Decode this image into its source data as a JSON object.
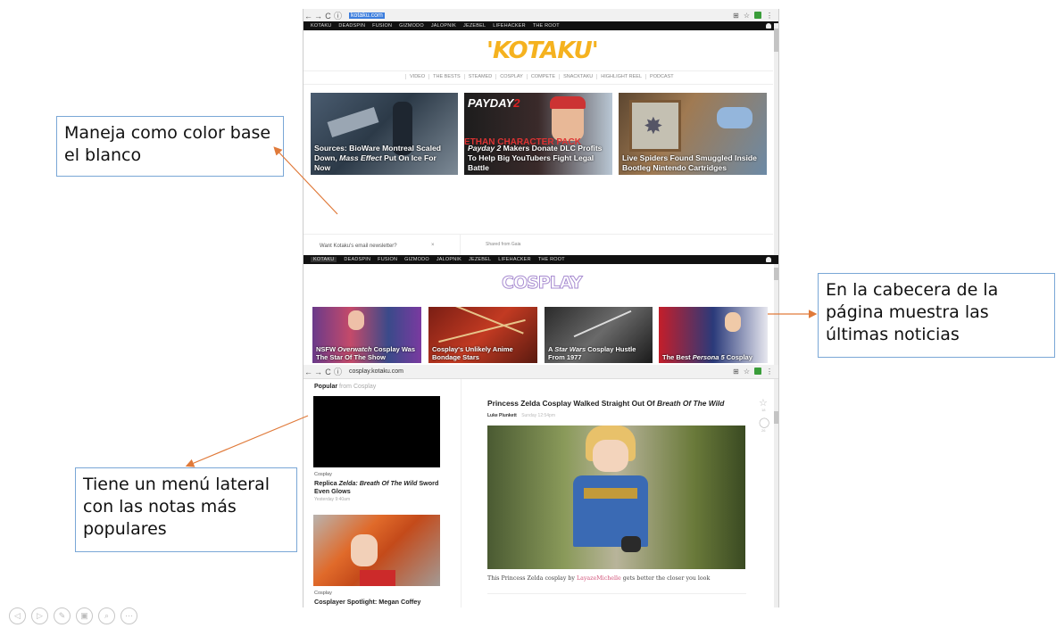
{
  "callouts": {
    "white": "Maneja como color base el blanco",
    "header_news": "En la cabecera de la página muestra las últimas noticias",
    "side_menu": "Tiene un menú lateral con las notas más populares"
  },
  "browser_top": {
    "url": "kotaku.com"
  },
  "browser_bottom": {
    "url": "cosplay.kotaku.com"
  },
  "network_nav": [
    "KOTAKU",
    "DEADSPIN",
    "FUSION",
    "GIZMODO",
    "JALOPNIK",
    "JEZEBEL",
    "LIFEHACKER",
    "THE ROOT"
  ],
  "kotaku": {
    "logo": "'KOTAKU'",
    "subnav": [
      "VIDEO",
      "THE BESTS",
      "STEAMED",
      "COSPLAY",
      "COMPETE",
      "SNACKTAKU",
      "HIGHLIGHT REEL",
      "PODCAST"
    ],
    "cards": [
      {
        "caption_a": "Sources: BioWare Montreal Scaled Down, ",
        "caption_em": "Mass Effect",
        "caption_b": " Put On Ice For Now"
      },
      {
        "caption_a": "",
        "caption_em": "Payday 2",
        "caption_b": " Makers Donate DLC Profits To Help Big YouTubers Fight Legal Battle"
      },
      {
        "caption_a": "Live Spiders Found Smuggled Inside Bootleg Nintendo Cartridges",
        "caption_em": "",
        "caption_b": ""
      }
    ],
    "newsletter": "Want Kotaku's email newsletter?",
    "shared": "Shared from Gaia"
  },
  "cosplay": {
    "logo": "COSPLAY",
    "cards": [
      {
        "caption_a": "NSFW ",
        "caption_em": "Overwatch",
        "caption_b": " Cosplay Was The Star Of The Show"
      },
      {
        "caption_a": "Cosplay's Unlikely Anime Bondage Stars",
        "caption_em": "",
        "caption_b": ""
      },
      {
        "caption_a": "A ",
        "caption_em": "Star Wars",
        "caption_b": " Cosplay Hustle From 1977"
      },
      {
        "caption_a": "The Best ",
        "caption_em": "Persona 5",
        "caption_b": " Cosplay"
      }
    ],
    "popular_label": "Popular",
    "popular_from": "from Cosplay",
    "side_items": [
      {
        "category": "Cosplay",
        "title_a": "Replica ",
        "title_em": "Zelda: Breath Of The Wild",
        "title_b": " Sword Even Glows",
        "time": "Yesterday 9:40am"
      },
      {
        "category": "Cosplay",
        "title_a": "Cosplayer Spotlight: Megan Coffey",
        "title_em": "",
        "title_b": "",
        "time": ""
      }
    ],
    "article": {
      "title_a": "Princess Zelda Cosplay Walked Straight Out Of ",
      "title_em": "Breath Of The Wild",
      "author": "Luke Plunkett",
      "time": "Sunday 12:54pm",
      "body_a": "This Princess Zelda cosplay by ",
      "body_link": "LayazeMichelle",
      "body_b": " gets better the closer you look"
    }
  },
  "colors": {
    "kotaku_yellow": "#f5b21f",
    "callout_border": "#7aa7d6",
    "arrow": "#e07a3a",
    "link": "#d2547a"
  }
}
